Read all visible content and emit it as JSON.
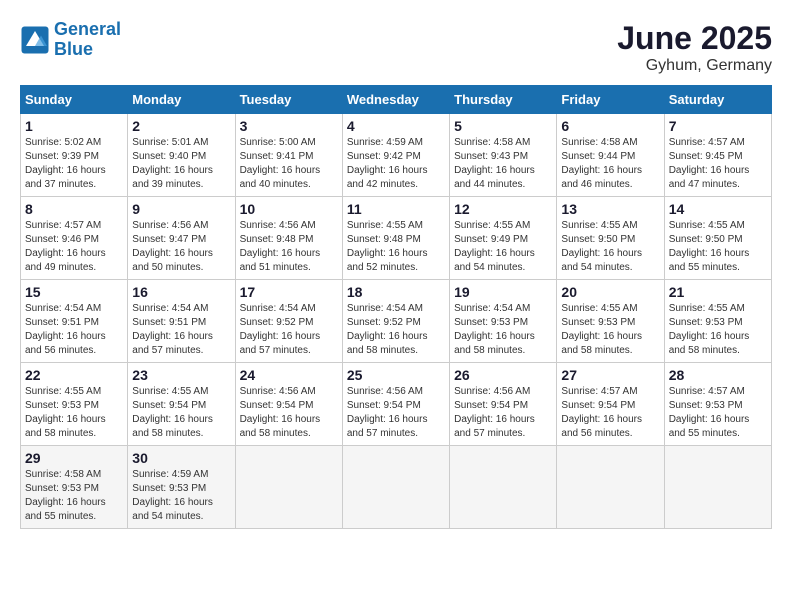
{
  "header": {
    "logo_line1": "General",
    "logo_line2": "Blue",
    "month_title": "June 2025",
    "location": "Gyhum, Germany"
  },
  "calendar": {
    "days_of_week": [
      "Sunday",
      "Monday",
      "Tuesday",
      "Wednesday",
      "Thursday",
      "Friday",
      "Saturday"
    ],
    "weeks": [
      [
        {
          "day": "",
          "info": ""
        },
        {
          "day": "2",
          "info": "Sunrise: 5:01 AM\nSunset: 9:40 PM\nDaylight: 16 hours\nand 39 minutes."
        },
        {
          "day": "3",
          "info": "Sunrise: 5:00 AM\nSunset: 9:41 PM\nDaylight: 16 hours\nand 40 minutes."
        },
        {
          "day": "4",
          "info": "Sunrise: 4:59 AM\nSunset: 9:42 PM\nDaylight: 16 hours\nand 42 minutes."
        },
        {
          "day": "5",
          "info": "Sunrise: 4:58 AM\nSunset: 9:43 PM\nDaylight: 16 hours\nand 44 minutes."
        },
        {
          "day": "6",
          "info": "Sunrise: 4:58 AM\nSunset: 9:44 PM\nDaylight: 16 hours\nand 46 minutes."
        },
        {
          "day": "7",
          "info": "Sunrise: 4:57 AM\nSunset: 9:45 PM\nDaylight: 16 hours\nand 47 minutes."
        }
      ],
      [
        {
          "day": "1",
          "info": "Sunrise: 5:02 AM\nSunset: 9:39 PM\nDaylight: 16 hours\nand 37 minutes."
        },
        null,
        null,
        null,
        null,
        null,
        null
      ],
      [
        {
          "day": "8",
          "info": "Sunrise: 4:57 AM\nSunset: 9:46 PM\nDaylight: 16 hours\nand 49 minutes."
        },
        {
          "day": "9",
          "info": "Sunrise: 4:56 AM\nSunset: 9:47 PM\nDaylight: 16 hours\nand 50 minutes."
        },
        {
          "day": "10",
          "info": "Sunrise: 4:56 AM\nSunset: 9:48 PM\nDaylight: 16 hours\nand 51 minutes."
        },
        {
          "day": "11",
          "info": "Sunrise: 4:55 AM\nSunset: 9:48 PM\nDaylight: 16 hours\nand 52 minutes."
        },
        {
          "day": "12",
          "info": "Sunrise: 4:55 AM\nSunset: 9:49 PM\nDaylight: 16 hours\nand 54 minutes."
        },
        {
          "day": "13",
          "info": "Sunrise: 4:55 AM\nSunset: 9:50 PM\nDaylight: 16 hours\nand 54 minutes."
        },
        {
          "day": "14",
          "info": "Sunrise: 4:55 AM\nSunset: 9:50 PM\nDaylight: 16 hours\nand 55 minutes."
        }
      ],
      [
        {
          "day": "15",
          "info": "Sunrise: 4:54 AM\nSunset: 9:51 PM\nDaylight: 16 hours\nand 56 minutes."
        },
        {
          "day": "16",
          "info": "Sunrise: 4:54 AM\nSunset: 9:51 PM\nDaylight: 16 hours\nand 57 minutes."
        },
        {
          "day": "17",
          "info": "Sunrise: 4:54 AM\nSunset: 9:52 PM\nDaylight: 16 hours\nand 57 minutes."
        },
        {
          "day": "18",
          "info": "Sunrise: 4:54 AM\nSunset: 9:52 PM\nDaylight: 16 hours\nand 58 minutes."
        },
        {
          "day": "19",
          "info": "Sunrise: 4:54 AM\nSunset: 9:53 PM\nDaylight: 16 hours\nand 58 minutes."
        },
        {
          "day": "20",
          "info": "Sunrise: 4:55 AM\nSunset: 9:53 PM\nDaylight: 16 hours\nand 58 minutes."
        },
        {
          "day": "21",
          "info": "Sunrise: 4:55 AM\nSunset: 9:53 PM\nDaylight: 16 hours\nand 58 minutes."
        }
      ],
      [
        {
          "day": "22",
          "info": "Sunrise: 4:55 AM\nSunset: 9:53 PM\nDaylight: 16 hours\nand 58 minutes."
        },
        {
          "day": "23",
          "info": "Sunrise: 4:55 AM\nSunset: 9:54 PM\nDaylight: 16 hours\nand 58 minutes."
        },
        {
          "day": "24",
          "info": "Sunrise: 4:56 AM\nSunset: 9:54 PM\nDaylight: 16 hours\nand 58 minutes."
        },
        {
          "day": "25",
          "info": "Sunrise: 4:56 AM\nSunset: 9:54 PM\nDaylight: 16 hours\nand 57 minutes."
        },
        {
          "day": "26",
          "info": "Sunrise: 4:56 AM\nSunset: 9:54 PM\nDaylight: 16 hours\nand 57 minutes."
        },
        {
          "day": "27",
          "info": "Sunrise: 4:57 AM\nSunset: 9:54 PM\nDaylight: 16 hours\nand 56 minutes."
        },
        {
          "day": "28",
          "info": "Sunrise: 4:57 AM\nSunset: 9:53 PM\nDaylight: 16 hours\nand 55 minutes."
        }
      ],
      [
        {
          "day": "29",
          "info": "Sunrise: 4:58 AM\nSunset: 9:53 PM\nDaylight: 16 hours\nand 55 minutes."
        },
        {
          "day": "30",
          "info": "Sunrise: 4:59 AM\nSunset: 9:53 PM\nDaylight: 16 hours\nand 54 minutes."
        },
        {
          "day": "",
          "info": ""
        },
        {
          "day": "",
          "info": ""
        },
        {
          "day": "",
          "info": ""
        },
        {
          "day": "",
          "info": ""
        },
        {
          "day": "",
          "info": ""
        }
      ]
    ]
  }
}
